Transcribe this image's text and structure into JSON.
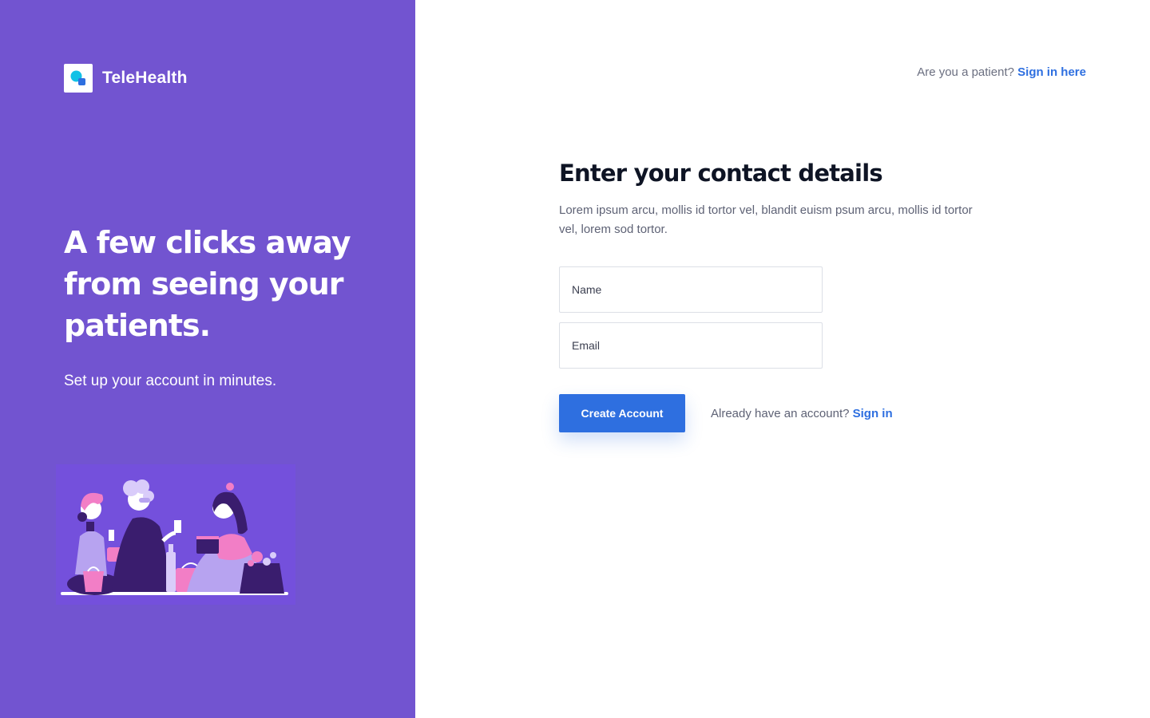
{
  "colors": {
    "panel": "#7254D0",
    "accent": "#2E6FE0",
    "logo_primary": "#12C1E6",
    "logo_secondary": "#2E6FE0"
  },
  "brand": {
    "name": "TeleHealth",
    "logo_icon": "chat-bubbles-logo"
  },
  "hero": {
    "heading": "A few clicks away from seeing your patients.",
    "subheading": "Set up your account in minutes.",
    "illustration": "people-celebrating-illustration"
  },
  "header": {
    "patient_prompt": "Are you a patient?",
    "patient_signin_link": "Sign in here"
  },
  "form": {
    "title": "Enter your contact details",
    "description": "Lorem ipsum arcu, mollis id tortor vel, blandit euism psum arcu, mollis id tortor vel, lorem sod tortor.",
    "name_placeholder": "Name",
    "email_placeholder": "Email",
    "submit_label": "Create Account",
    "signin_prompt": "Already have an account?",
    "signin_link": "Sign in"
  }
}
